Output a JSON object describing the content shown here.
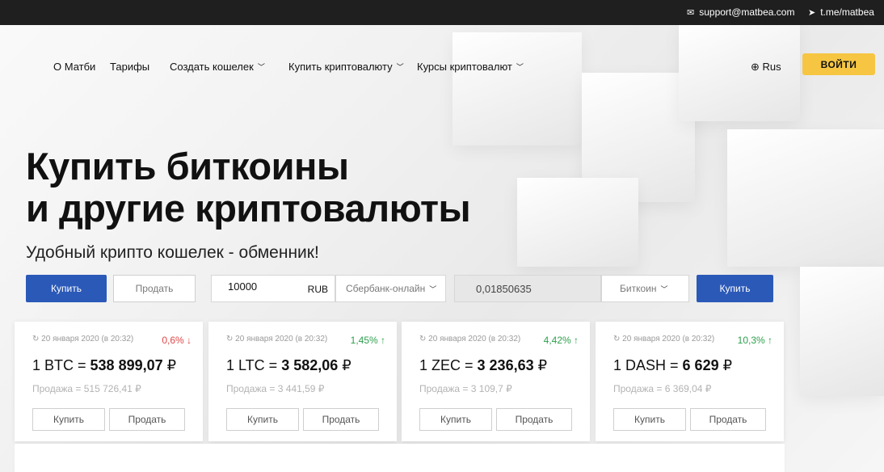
{
  "topbar": {
    "email": "support@matbea.com",
    "telegram": "t.me/matbea",
    "email_icon": "mail-icon",
    "telegram_icon": "telegram-icon"
  },
  "nav": {
    "items": [
      {
        "label": "О Матби"
      },
      {
        "label": "Тарифы"
      },
      {
        "label": "Создать кошелек"
      },
      {
        "label": "Купить криптовалюту"
      },
      {
        "label": "Курсы криптовалют"
      }
    ],
    "language": "Rus",
    "login": "ВОЙТИ"
  },
  "hero": {
    "title_line1": "Купить биткоины",
    "title_line2": "и другие криптовалюты",
    "subtitle": "Удобный крипто кошелек - обменник!"
  },
  "exchange": {
    "buy_tab": "Купить",
    "sell_tab": "Продать",
    "amount": "10000",
    "currency": "RUB",
    "payment_method": "Сбербанк-онлайн",
    "result_amount": "0,01850635",
    "crypto": "Биткоин",
    "submit": "Купить"
  },
  "cards": [
    {
      "date": "20 января 2020 (в 20:32)",
      "change": "0,6% ↓",
      "direction": "down",
      "price_prefix": "1 BTC = ",
      "price_value": "538 899,07",
      "currency_symbol": " ₽",
      "sell": "Продажа = 515 726,41 ₽",
      "buy_label": "Купить",
      "sell_label": "Продать"
    },
    {
      "date": "20 января 2020 (в 20:32)",
      "change": "1,45% ↑",
      "direction": "up",
      "price_prefix": "1 LTC = ",
      "price_value": "3 582,06",
      "currency_symbol": " ₽",
      "sell": "Продажа = 3 441,59 ₽",
      "buy_label": "Купить",
      "sell_label": "Продать"
    },
    {
      "date": "20 января 2020 (в 20:32)",
      "change": "4,42% ↑",
      "direction": "up",
      "price_prefix": "1 ZEC = ",
      "price_value": "3 236,63",
      "currency_symbol": " ₽",
      "sell": "Продажа = 3 109,7 ₽",
      "buy_label": "Купить",
      "sell_label": "Продать"
    },
    {
      "date": "20 января 2020 (в 20:32)",
      "change": "10,3% ↑",
      "direction": "up",
      "price_prefix": "1 DASH = ",
      "price_value": "6 629",
      "currency_symbol": " ₽",
      "sell": "Продажа = 6 369,04 ₽",
      "buy_label": "Купить",
      "sell_label": "Продать"
    }
  ],
  "colors": {
    "accent_blue": "#2b59b8",
    "login_yellow": "#f6c642",
    "up_green": "#2ea04d",
    "down_red": "#e04646",
    "topbar_bg": "#1f1f1f"
  }
}
